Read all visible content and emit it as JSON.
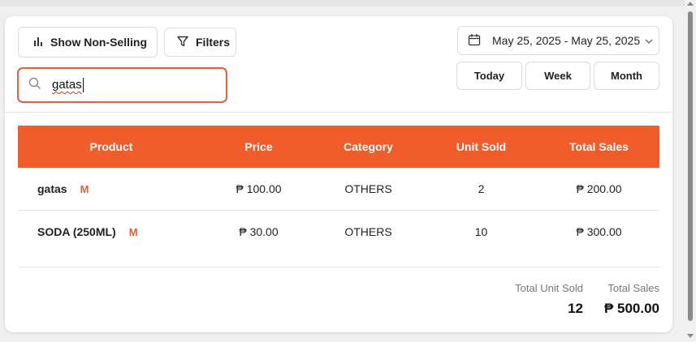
{
  "toolbar": {
    "non_selling_label": "Show Non-Selling",
    "filters_label": "Filters"
  },
  "search": {
    "value": "gatas",
    "placeholder": ""
  },
  "date_range": {
    "label": "May 25, 2025 - May 25, 2025"
  },
  "quick_ranges": [
    "Today",
    "Week",
    "Month"
  ],
  "table": {
    "headers": [
      "Product",
      "Price",
      "Category",
      "Unit Sold",
      "Total Sales"
    ],
    "rows": [
      {
        "product": "gatas",
        "badge": "M",
        "price": "₱ 100.00",
        "category": "OTHERS",
        "unit_sold": "2",
        "total_sales": "₱ 200.00"
      },
      {
        "product": "SODA (250ML)",
        "badge": "M",
        "price": "₱ 30.00",
        "category": "OTHERS",
        "unit_sold": "10",
        "total_sales": "₱ 300.00"
      }
    ]
  },
  "totals": {
    "unit_sold_label": "Total Unit Sold",
    "unit_sold_value": "12",
    "sales_label": "Total Sales",
    "sales_value": "₱ 500.00"
  },
  "colors": {
    "accent": "#f15c2b",
    "search_border": "#e0603a"
  },
  "icons": {
    "non_selling": "bar-chart-icon",
    "filters": "filter-icon",
    "search": "search-icon",
    "date": "calendar-icon",
    "dropdown": "chevron-down-icon"
  }
}
